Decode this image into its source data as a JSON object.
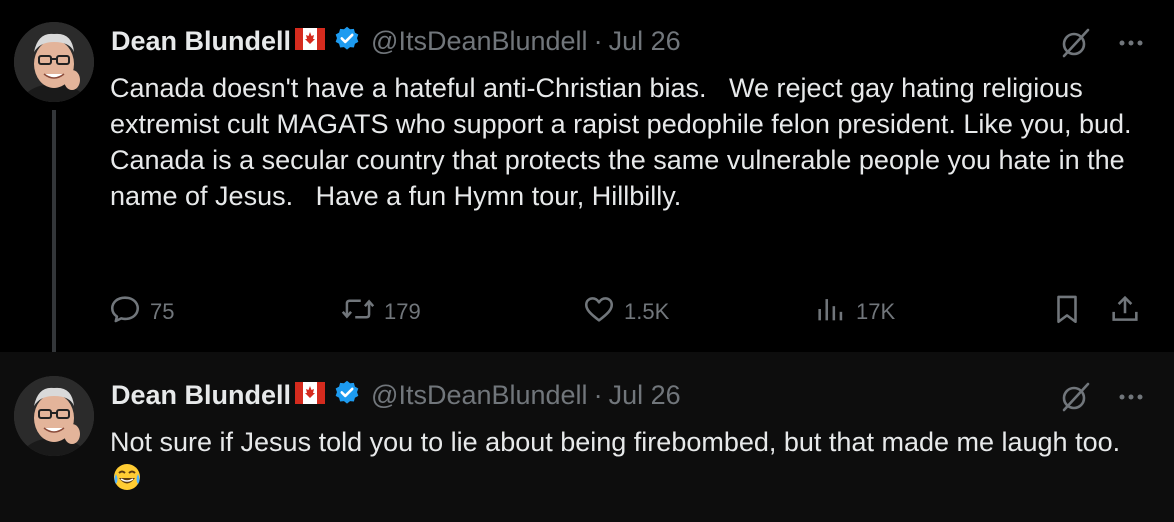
{
  "tweets": [
    {
      "name": "Dean Blundell",
      "handle": "@ItsDeanBlundell",
      "separator": "·",
      "date": "Jul 26",
      "text": "Canada doesn't have a hateful anti-Christian bias.   We reject gay hating religious extremist cult MAGATS who support a rapist pedophile felon president. Like you, bud.   Canada is a secular country that protects the same vulnerable people you hate in the name of Jesus.   Have a fun Hymn tour, Hillbilly.",
      "stats": {
        "replies": "75",
        "reposts": "179",
        "likes": "1.5K",
        "views": "17K"
      }
    },
    {
      "name": "Dean Blundell",
      "handle": "@ItsDeanBlundell",
      "separator": "·",
      "date": "Jul 26",
      "text": "Not sure if Jesus told you to lie about being firebombed, but that made me laugh too.",
      "emoji": "face-with-tears-of-joy"
    }
  ],
  "colors": {
    "background": "#000000",
    "text": "#e7e9ea",
    "secondary": "#71767b",
    "verified": "#1d9bf0",
    "flag_red": "#d52b1e"
  },
  "icons": [
    "canada-flag-icon",
    "verified-badge-icon",
    "grok-icon",
    "more-icon",
    "reply-icon",
    "repost-icon",
    "like-icon",
    "views-icon",
    "bookmark-icon",
    "share-icon",
    "tears-of-joy-emoji"
  ]
}
